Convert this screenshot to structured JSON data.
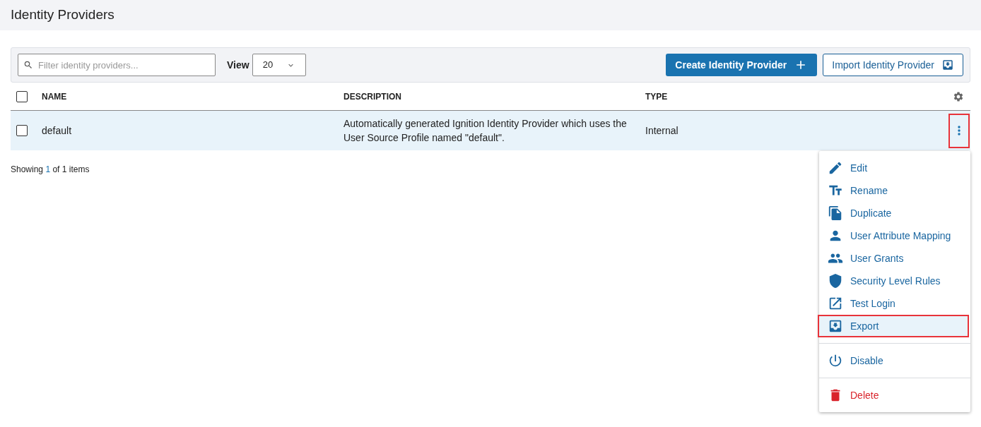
{
  "page_title": "Identity Providers",
  "toolbar": {
    "search": {
      "placeholder": "Filter identity providers..."
    },
    "view_label": "View",
    "view_value": "20",
    "buttons": [
      {
        "label": "Create Identity Provider",
        "kind": "primary"
      },
      {
        "label": "Import Identity Provider",
        "kind": "secondary"
      }
    ]
  },
  "table": {
    "columns": [
      "NAME",
      "DESCRIPTION",
      "TYPE"
    ],
    "header_checked": false,
    "rows": [
      {
        "checked": false,
        "selected": true,
        "cells": [
          "default",
          "Automatically generated Ignition Identity Provider which uses the User Source Profile named \"default\".",
          "Internal"
        ],
        "actions_annotated": true
      }
    ]
  },
  "footer": {
    "prefix": "Showing",
    "count": "1",
    "suffix": "of 1 items"
  },
  "menu": {
    "groups": [
      [
        {
          "label": "Edit",
          "kind": "normal",
          "selected": false,
          "annotated": false
        },
        {
          "label": "Rename",
          "kind": "normal",
          "selected": false,
          "annotated": false
        },
        {
          "label": "Duplicate",
          "kind": "normal",
          "selected": false,
          "annotated": false
        },
        {
          "label": "User Attribute Mapping",
          "kind": "normal",
          "selected": false,
          "annotated": false
        },
        {
          "label": "User Grants",
          "kind": "normal",
          "selected": false,
          "annotated": false
        },
        {
          "label": "Security Level Rules",
          "kind": "normal",
          "selected": false,
          "annotated": false
        },
        {
          "label": "Test Login",
          "kind": "normal",
          "selected": false,
          "annotated": false
        },
        {
          "label": "Export",
          "kind": "normal",
          "selected": true,
          "annotated": true
        }
      ],
      [
        {
          "label": "Disable",
          "kind": "normal",
          "selected": false,
          "annotated": false
        }
      ],
      [
        {
          "label": "Delete",
          "kind": "danger",
          "selected": false,
          "annotated": false
        }
      ]
    ]
  }
}
